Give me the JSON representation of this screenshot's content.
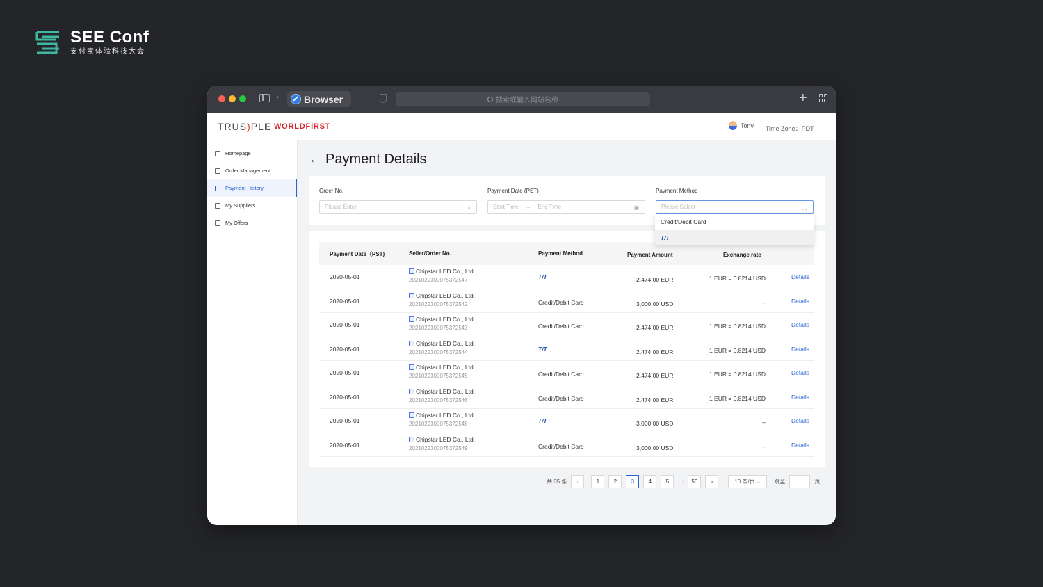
{
  "brand": {
    "title": "SEE Conf",
    "subtitle": "支付宝体验科技大会"
  },
  "browser": {
    "tab_label": "Browser",
    "url_placeholder": "搜索或输入网站名称"
  },
  "header": {
    "logo_left": "TRUS",
    "logo_mid": ")",
    "logo_right": "PLE",
    "partner": "WORLDFIRST",
    "user_name": "Tony",
    "timezone": "Time Zone：PDT"
  },
  "sidebar": {
    "items": [
      {
        "label": "Homepage",
        "icon": "home-icon"
      },
      {
        "label": "Order Management",
        "icon": "file-icon"
      },
      {
        "label": "Payment History",
        "icon": "payment-icon"
      },
      {
        "label": "My Suppliers",
        "icon": "supplier-icon"
      },
      {
        "label": "My Offers",
        "icon": "offer-icon"
      }
    ],
    "active_index": 2
  },
  "page": {
    "title": "Payment Details"
  },
  "filters": {
    "order_label": "Order No.",
    "order_placeholder": "Please Enter",
    "date_label": "Payment Date (PST)",
    "date_start": "Start Time",
    "date_end": "End Time",
    "method_label": "Payment Method",
    "method_placeholder": "Please Select",
    "method_options": [
      "Credit/Debit Card",
      "T/T"
    ]
  },
  "table": {
    "headers": [
      "Payment Date（PST)",
      "Seller/Order No.",
      "Payment Method",
      "Payment Amount",
      "Exchange rate"
    ],
    "rows": [
      {
        "date": "2020-05-01",
        "seller": "Chipstar LED Co., Ltd.",
        "order": "20210223000753725​47",
        "method": "T/T",
        "amount": "2,474.00 EUR",
        "rate": "1 EUR = 0.8214 USD",
        "action": "Details"
      },
      {
        "date": "2020-05-01",
        "seller": "Chipstar LED Co., Ltd.",
        "order": "2021022300075372542",
        "method": "Credit/Debit Card",
        "amount": "3,000.00 USD",
        "rate": "–",
        "action": "Details"
      },
      {
        "date": "2020-05-01",
        "seller": "Chipstar LED Co., Ltd.",
        "order": "2021022300075372543",
        "method": "Credit/Debit Card",
        "amount": "2,474.00 EUR",
        "rate": "1 EUR = 0.8214 USD",
        "action": "Details"
      },
      {
        "date": "2020-05-01",
        "seller": "Chipstar LED Co., Ltd.",
        "order": "2021022300075372544",
        "method": "T/T",
        "amount": "2,474.00 EUR",
        "rate": "1 EUR = 0.8214 USD",
        "action": "Details"
      },
      {
        "date": "2020-05-01",
        "seller": "Chipstar LED Co., Ltd.",
        "order": "2021022300075372545",
        "method": "Credit/Debit Card",
        "amount": "2,474.00 EUR",
        "rate": "1 EUR = 0.8214 USD",
        "action": "Details"
      },
      {
        "date": "2020-05-01",
        "seller": "Chipstar LED Co., Ltd.",
        "order": "2021022300075372546",
        "method": "Credit/Debit Card",
        "amount": "2,474.00 EUR",
        "rate": "1 EUR = 0.8214 USD",
        "action": "Details"
      },
      {
        "date": "2020-05-01",
        "seller": "Chipstar LED Co., Ltd.",
        "order": "2021022300075372548",
        "method": "T/T",
        "amount": "3,000.00 USD",
        "rate": "–",
        "action": "Details"
      },
      {
        "date": "2020-05-01",
        "seller": "Chipstar LED Co., Ltd.",
        "order": "2021022300075372549",
        "method": "Credit/Debit Card",
        "amount": "3,000.00 USD",
        "rate": "–",
        "action": "Details"
      }
    ]
  },
  "pagination": {
    "total": "共 35 条",
    "pages": [
      "1",
      "2",
      "3",
      "4",
      "5"
    ],
    "ellipsis": "···",
    "last": "50",
    "current": "3",
    "page_size": "10 条/页",
    "jump_label": "跳至",
    "jump_suffix": "页",
    "prev": "‹",
    "next": "›"
  }
}
